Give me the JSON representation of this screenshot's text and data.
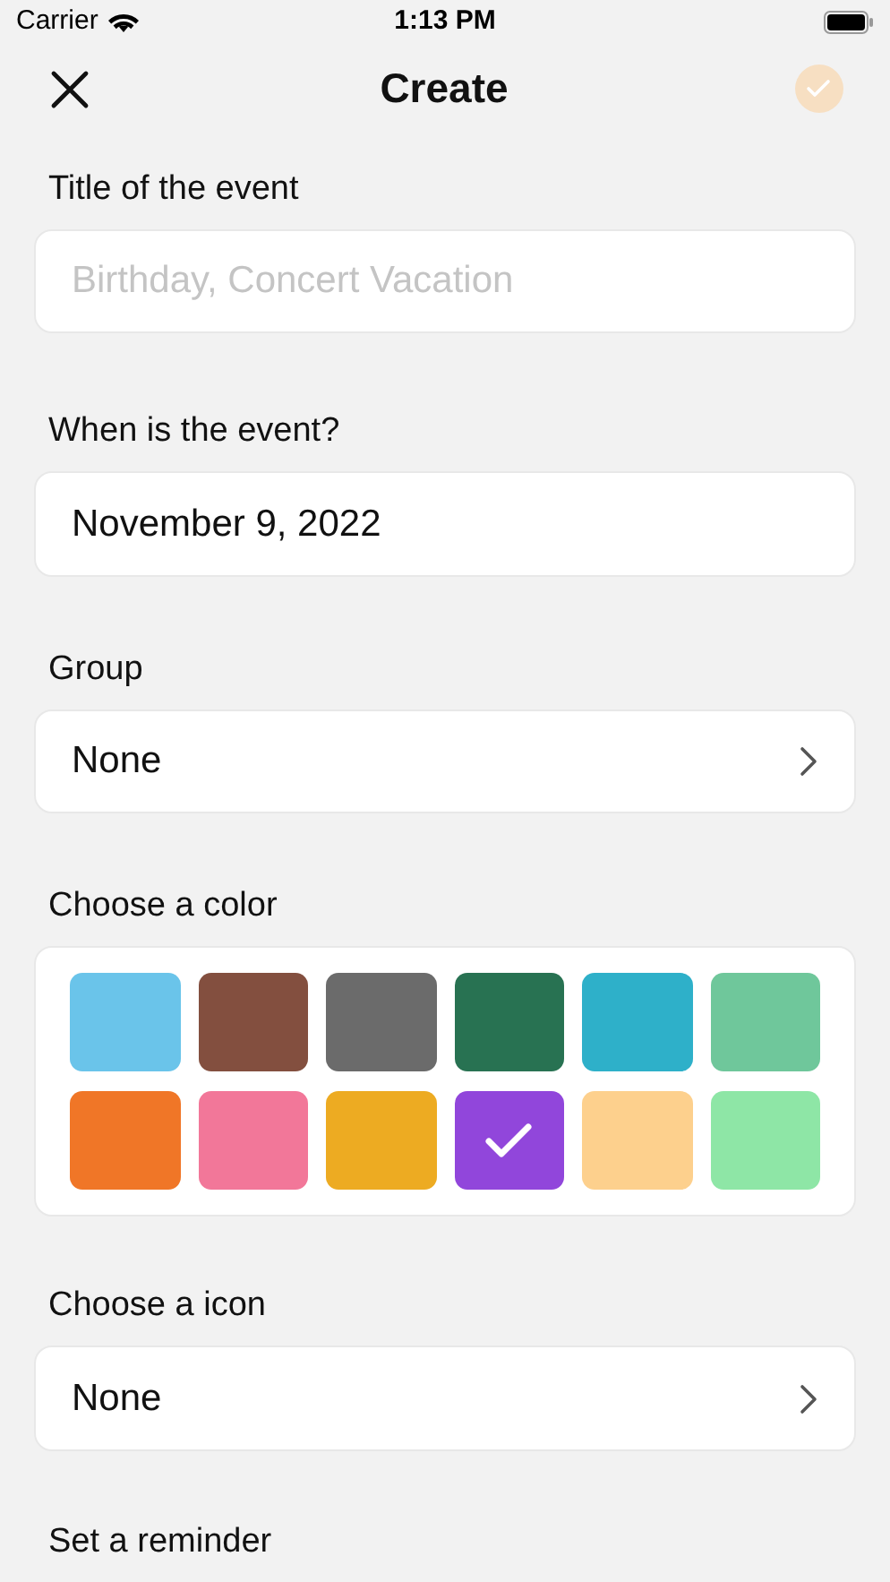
{
  "status_bar": {
    "carrier": "Carrier",
    "time": "1:13 PM"
  },
  "header": {
    "title": "Create",
    "save_disabled": true
  },
  "title_field": {
    "label": "Title of the event",
    "placeholder": "Birthday, Concert Vacation"
  },
  "date_field": {
    "label": "When is the event?",
    "value": "November 9, 2022"
  },
  "group": {
    "label": "Group",
    "value": "None"
  },
  "colors": {
    "label": "Choose a color",
    "swatches": [
      {
        "color": "#6ac4ea",
        "selected": false
      },
      {
        "color": "#834f3f",
        "selected": false
      },
      {
        "color": "#6b6b6b",
        "selected": false
      },
      {
        "color": "#287252",
        "selected": false
      },
      {
        "color": "#2eb0c9",
        "selected": false
      },
      {
        "color": "#6fc79b",
        "selected": false
      },
      {
        "color": "#f07627",
        "selected": false
      },
      {
        "color": "#f27799",
        "selected": false
      },
      {
        "color": "#edab22",
        "selected": false
      },
      {
        "color": "#9146db",
        "selected": true
      },
      {
        "color": "#fdd08d",
        "selected": false
      },
      {
        "color": "#8ee6a6",
        "selected": false
      }
    ]
  },
  "icon": {
    "label": "Choose a icon",
    "value": "None"
  },
  "reminder": {
    "label": "Set a reminder"
  }
}
